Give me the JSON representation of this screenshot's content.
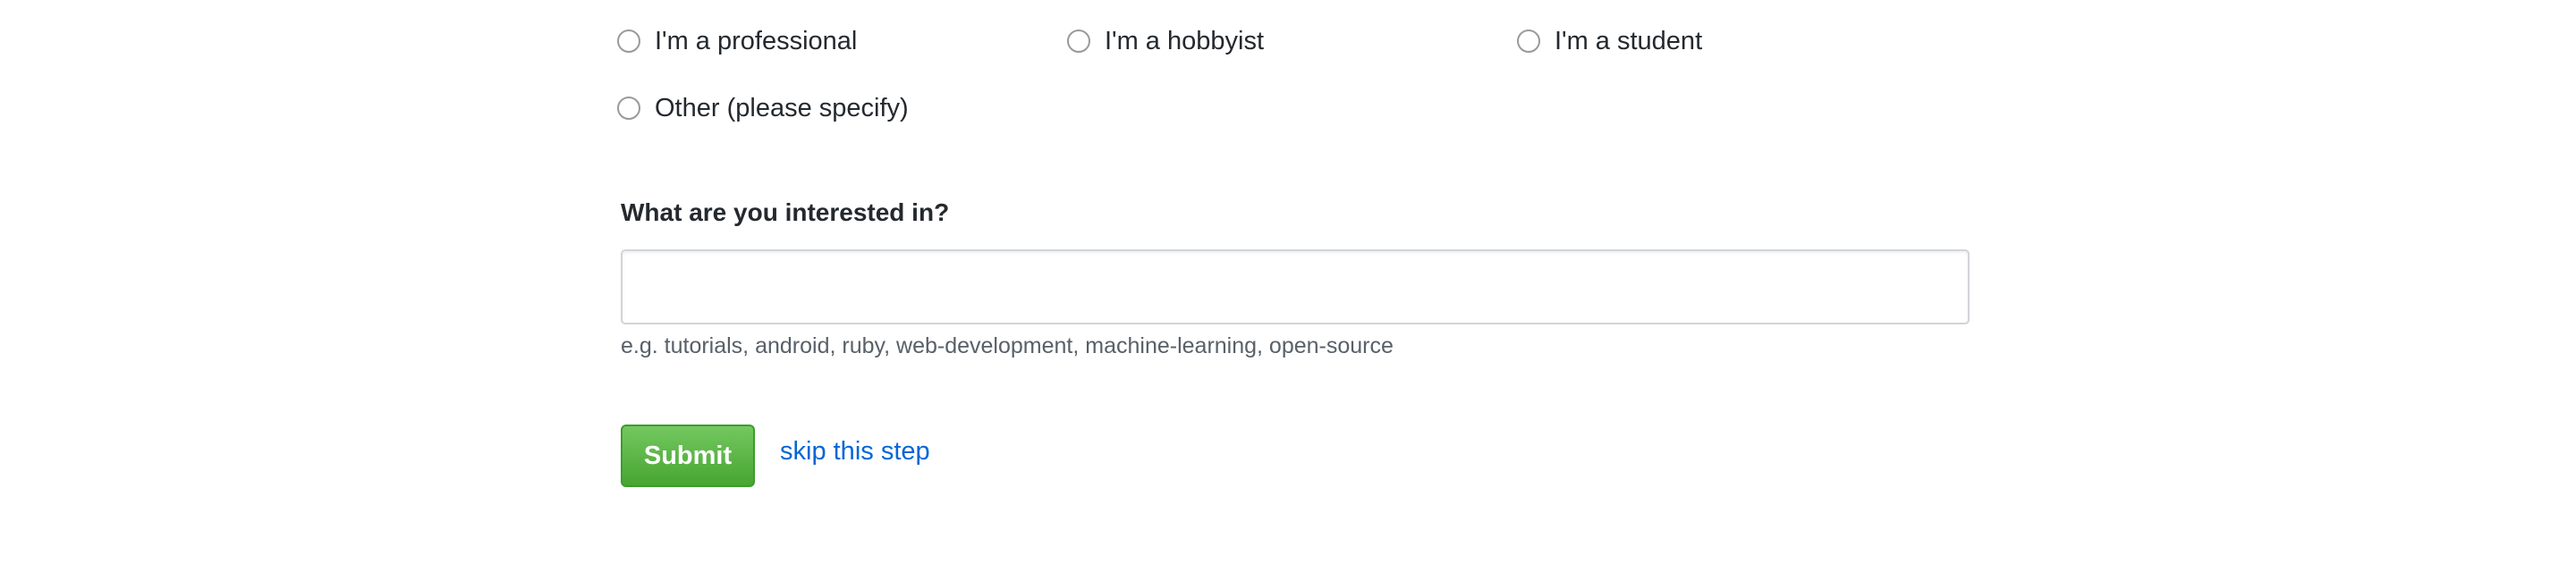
{
  "occupation": {
    "options": [
      {
        "label": "I'm a professional",
        "selected": false
      },
      {
        "label": "I'm a hobbyist",
        "selected": false
      },
      {
        "label": "I'm a student",
        "selected": false
      },
      {
        "label": "Other (please specify)",
        "selected": false
      }
    ]
  },
  "interests": {
    "question": "What are you interested in?",
    "input_value": "",
    "hint": "e.g. tutorials, android, ruby, web-development, machine-learning, open-source"
  },
  "actions": {
    "submit_label": "Submit",
    "skip_label": "skip this step"
  },
  "colors": {
    "submit_green": "#48a531",
    "link_blue": "#0366d6",
    "text": "#24292e",
    "hint_gray": "#586069"
  }
}
